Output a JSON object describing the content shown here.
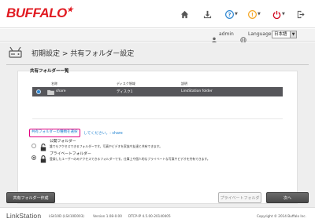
{
  "brand": {
    "logo": "BUFFALO",
    "logo_mark": "★"
  },
  "toolbar": {
    "icons": [
      "home-icon",
      "download-icon",
      "help-icon",
      "info-icon",
      "power-icon",
      "logout-icon"
    ],
    "colors": {
      "help": "#2e86d1",
      "info": "#f5a623",
      "power": "#d0021b",
      "neutral": "#555555"
    }
  },
  "langbar": {
    "user": "admin",
    "language_label": "Language",
    "language_value": "日本語"
  },
  "page": {
    "title": "初期設定 > 共有フォルダー設定"
  },
  "shares": {
    "section_label": "共有フォルダー一覧",
    "columns": {
      "name": "名称",
      "disk": "ディスク領域",
      "description": "説明"
    },
    "rows": [
      {
        "name": "share",
        "disk": "ディスク1",
        "description": "LinkStation folder",
        "selected": true
      }
    ]
  },
  "access": {
    "link_text": "共有フォルダーの種類を選択",
    "rest_text": "してください。: share",
    "options": [
      {
        "title": "公開フォルダー",
        "desc": "誰でもアクセスできるフォルダーです。写真やビデオを家族や友達と共有できます。",
        "checked": false
      },
      {
        "title": "プライベートフォルダー",
        "desc": "登録したユーザーのみアクセスできるフォルダーです。仕事上や個人的なプライベートな写真やビデオを共有できます。",
        "checked": true
      }
    ]
  },
  "buttons": {
    "create_share": "共有フォルダー作成",
    "private_folder": "プライベートフォルダー",
    "next": "次へ"
  },
  "footer": {
    "product": "LinkStation",
    "model": "LS410D (LS410D003)",
    "version": "Version 1.08-0.00",
    "dtcp": "DTCP-IP 4.5.00-20140405",
    "copyright": "Copyright © 2014 Buffalo Inc."
  }
}
